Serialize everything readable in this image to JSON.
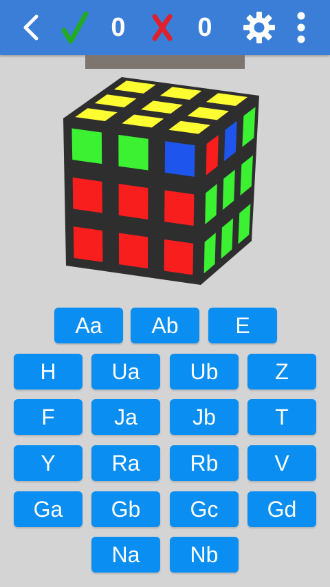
{
  "topbar": {
    "back_icon": "chevron-left-icon",
    "correct_icon": "check-icon",
    "correct_count": "0",
    "wrong_icon": "x-icon",
    "wrong_count": "0",
    "settings_icon": "gear-icon",
    "more_icon": "more-vertical-icon",
    "colors": {
      "bar": "#3a7ed8",
      "check": "#22aa22",
      "cross": "#e0202a"
    }
  },
  "progress": {
    "value": 0
  },
  "cube": {
    "top": [
      "yellow",
      "yellow",
      "yellow",
      "yellow",
      "yellow",
      "yellow",
      "yellow",
      "yellow",
      "yellow"
    ],
    "front_rows": [
      [
        "green",
        "green",
        "blue"
      ],
      [
        "red",
        "red",
        "red"
      ],
      [
        "red",
        "red",
        "red"
      ]
    ],
    "right_rows": [
      [
        "red",
        "blue",
        "green"
      ],
      [
        "green",
        "green",
        "green"
      ],
      [
        "green",
        "green",
        "green"
      ]
    ],
    "colors": {
      "yellow": "#fdfd32",
      "green": "#3bf132",
      "blue": "#1e56ed",
      "red": "#f81e1e"
    }
  },
  "keys": {
    "aa": "Aa",
    "ab": "Ab",
    "e": "E",
    "h": "H",
    "ua": "Ua",
    "ub": "Ub",
    "z": "Z",
    "f": "F",
    "ja": "Ja",
    "jb": "Jb",
    "t": "T",
    "y": "Y",
    "ra": "Ra",
    "rb": "Rb",
    "v": "V",
    "ga": "Ga",
    "gb": "Gb",
    "gc": "Gc",
    "gd": "Gd",
    "na": "Na",
    "nb": "Nb"
  }
}
